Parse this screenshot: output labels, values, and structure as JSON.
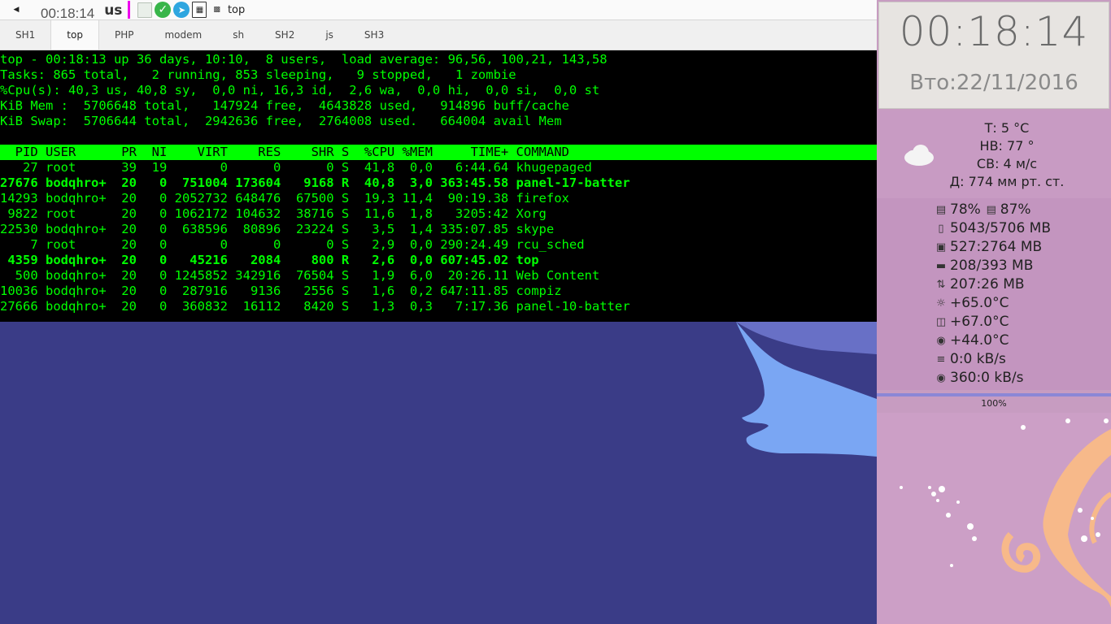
{
  "top_panel": {
    "clock": "00:18:14",
    "keyboard_layout": "us",
    "window_title": "top"
  },
  "tabs": [
    {
      "label": "SH1"
    },
    {
      "label": "top",
      "active": true
    },
    {
      "label": "PHP"
    },
    {
      "label": "modem"
    },
    {
      "label": "sh"
    },
    {
      "label": "SH2"
    },
    {
      "label": "js"
    },
    {
      "label": "SH3"
    }
  ],
  "terminal": {
    "summary": [
      "top - 00:18:13 up 36 days, 10:10,  8 users,  load average: 96,56, 100,21, 143,58",
      "Tasks: 865 total,   2 running, 853 sleeping,   9 stopped,   1 zombie",
      "%Cpu(s): 40,3 us, 40,8 sy,  0,0 ni, 16,3 id,  2,6 wa,  0,0 hi,  0,0 si,  0,0 st",
      "KiB Mem :  5706648 total,   147924 free,  4643828 used,   914896 buff/cache",
      "KiB Swap:  5706644 total,  2942636 free,  2764008 used.   664004 avail Mem"
    ],
    "header": "  PID USER      PR  NI    VIRT    RES    SHR S  %CPU %MEM     TIME+ COMMAND",
    "rows": [
      {
        "text": "   27 root      39  19       0      0      0 S  41,8  0,0   6:44.64 khugepaged",
        "bold": false
      },
      {
        "text": "27676 bodqhro+  20   0  751004 173604   9168 R  40,8  3,0 363:45.58 panel-17-batter",
        "bold": true
      },
      {
        "text": "14293 bodqhro+  20   0 2052732 648476  67500 S  19,3 11,4  90:19.38 firefox",
        "bold": false
      },
      {
        "text": " 9822 root      20   0 1062172 104632  38716 S  11,6  1,8   3205:42 Xorg",
        "bold": false
      },
      {
        "text": "22530 bodqhro+  20   0  638596  80896  23224 S   3,5  1,4 335:07.85 skype",
        "bold": false
      },
      {
        "text": "    7 root      20   0       0      0      0 S   2,9  0,0 290:24.49 rcu_sched",
        "bold": false
      },
      {
        "text": " 4359 bodqhro+  20   0   45216   2084    800 R   2,6  0,0 607:45.02 top",
        "bold": true
      },
      {
        "text": "  500 bodqhro+  20   0 1245852 342916  76504 S   1,9  6,0  20:26.11 Web Content",
        "bold": false
      },
      {
        "text": "10036 bodqhro+  20   0  287916   9136   2556 S   1,6  0,2 647:11.85 compiz",
        "bold": false
      },
      {
        "text": "27666 bodqhro+  20   0  360832  16112   8420 S   1,3  0,3   7:17.36 panel-10-batter",
        "bold": false
      }
    ]
  },
  "conky": {
    "time": "00:18:14",
    "date": "Вто:22/11/2016",
    "weather": {
      "icon": "cloud-icon",
      "temp": "Т: 5 °C",
      "direction": "НВ: 77 °",
      "wind": "СВ: 4 м/с",
      "pressure": "Д: 774 мм рт. ст."
    },
    "stats": {
      "cpu1": "78%",
      "cpu2": "87%",
      "ram": "5043/5706 MB",
      "swap": "527:2764 MB",
      "video_mem": "208/393 MB",
      "disk": "207:26 MB",
      "cpu_temp": "+65.0°C",
      "gpu_temp": "+67.0°C",
      "hdd_temp": "+44.0°C",
      "net_up": "0:0 kB/s",
      "net_down": "360:0 kB/s"
    },
    "battery": {
      "value": 1.0,
      "label": "100%"
    }
  }
}
